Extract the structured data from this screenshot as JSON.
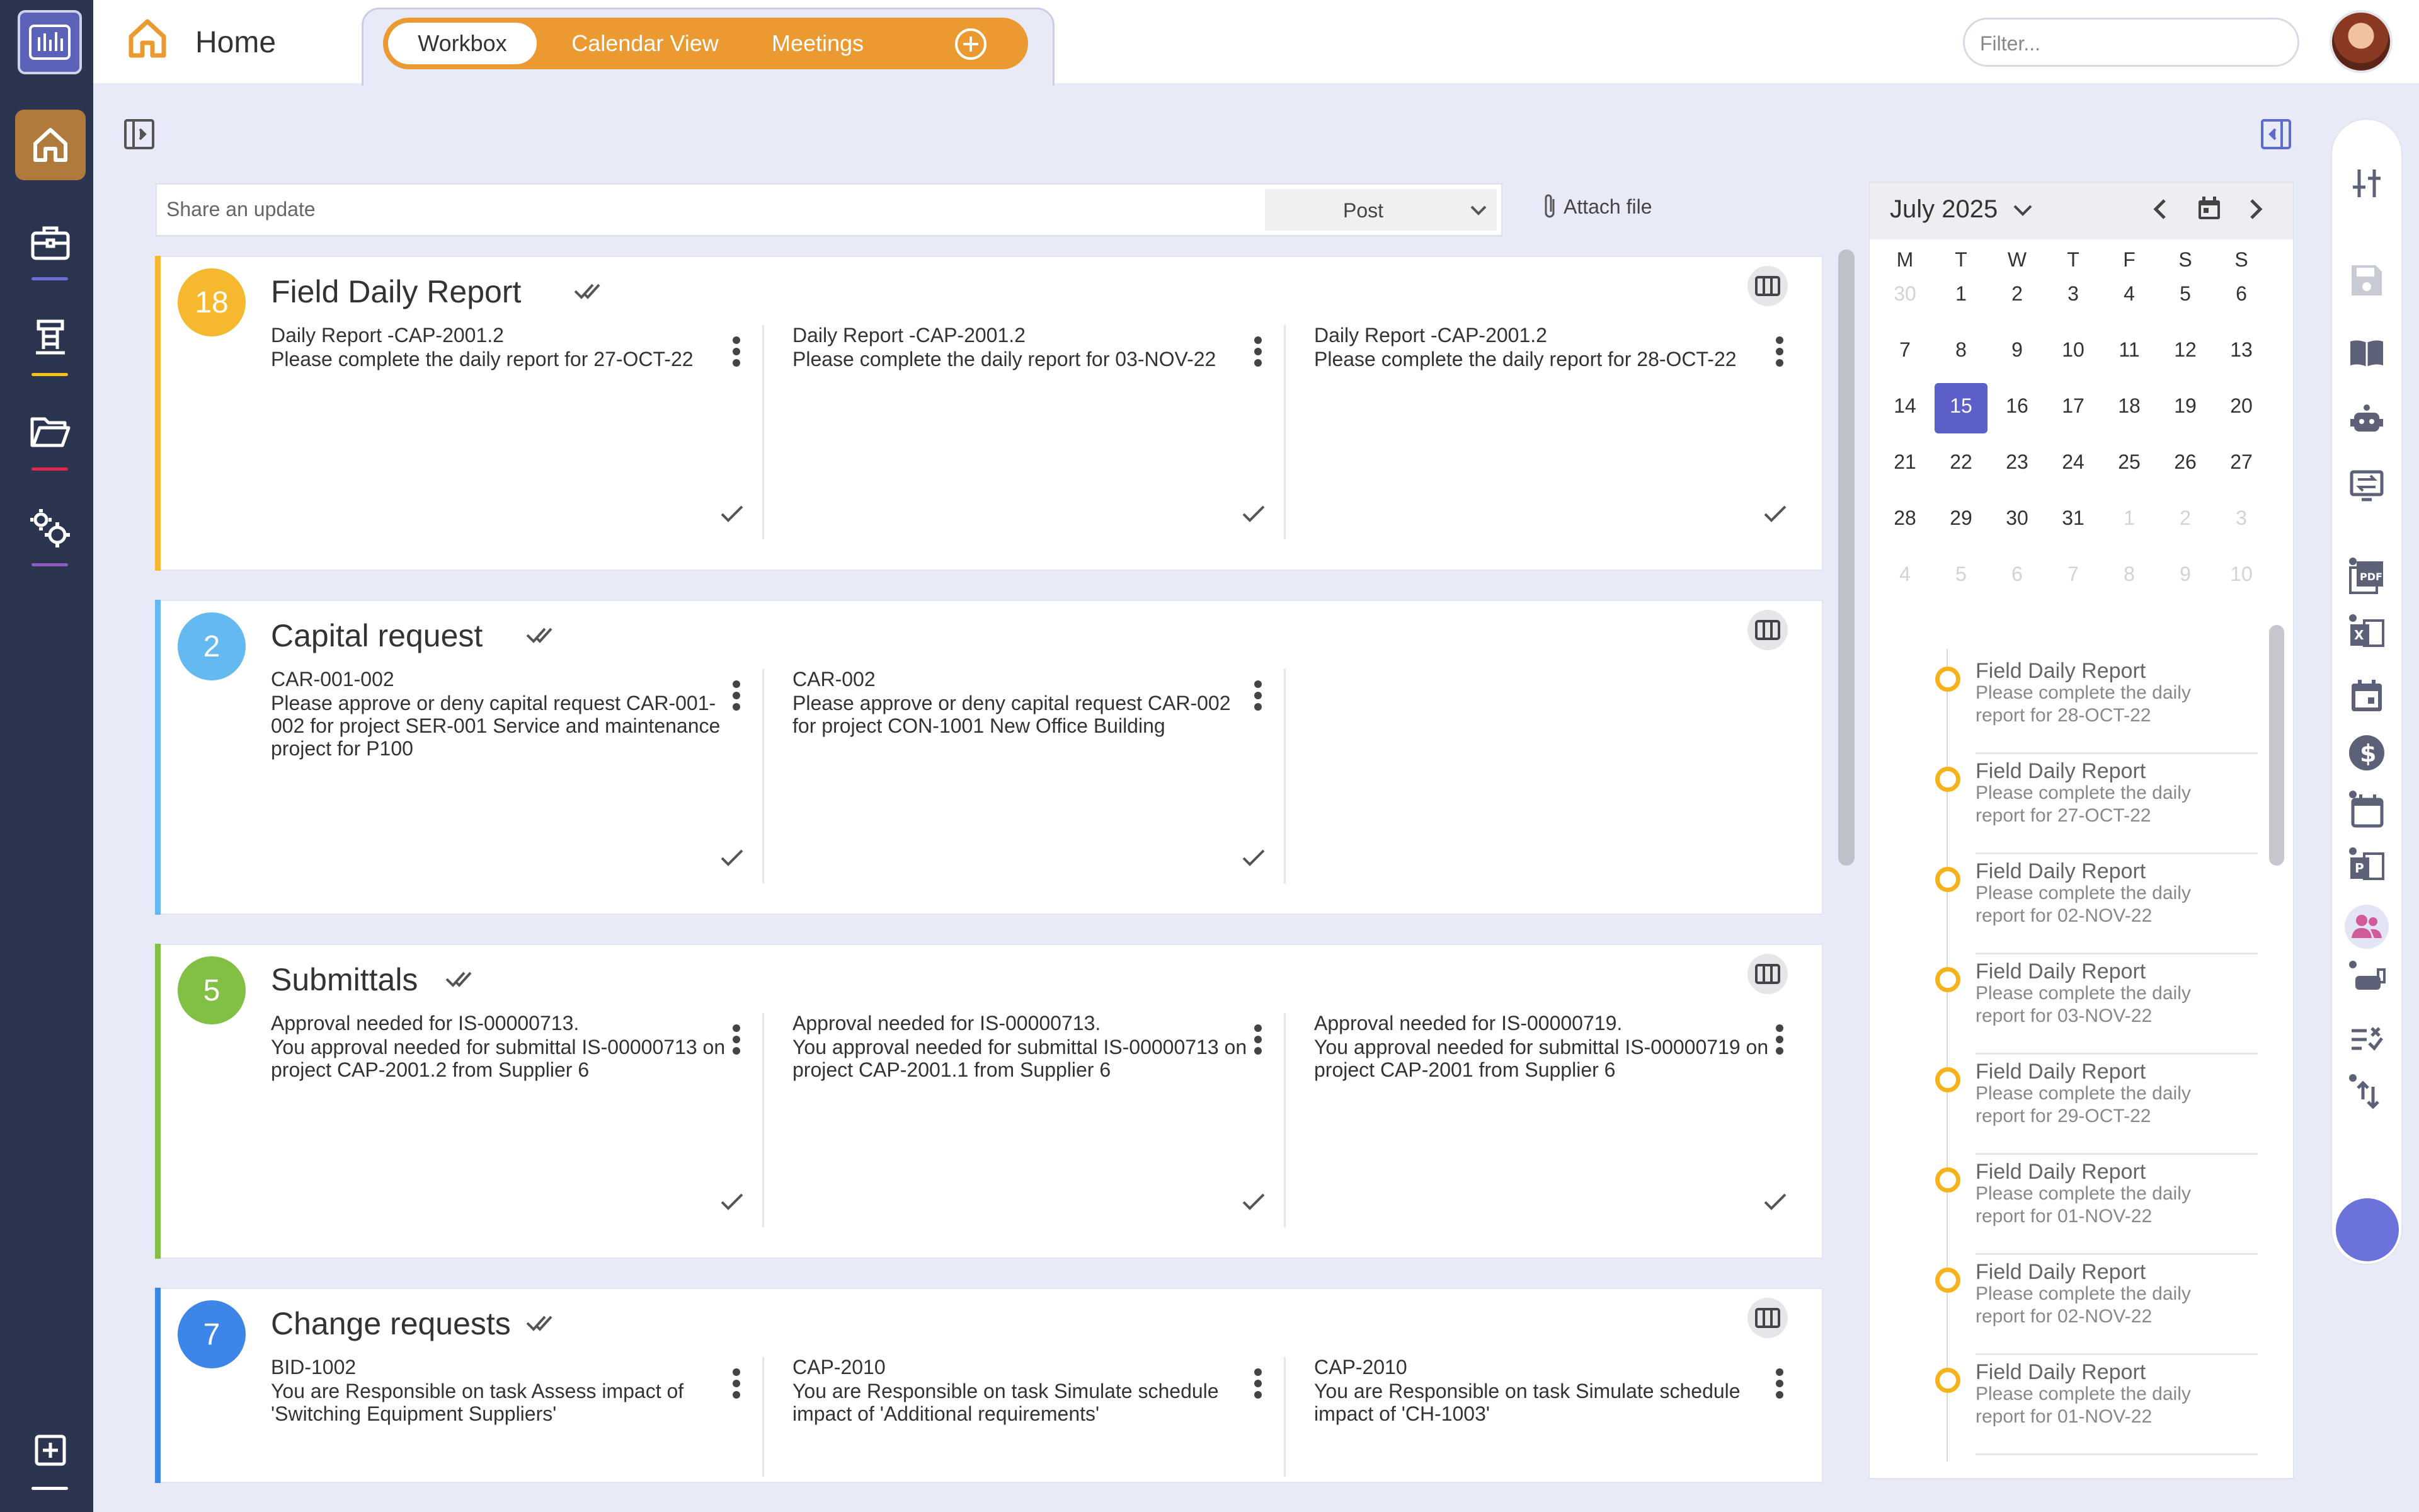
{
  "header": {
    "home_label": "Home",
    "tabs": [
      {
        "label": "Workbox",
        "active": true
      },
      {
        "label": "Calendar View",
        "active": false
      },
      {
        "label": "Meetings",
        "active": false
      }
    ],
    "filter_placeholder": "Filter..."
  },
  "compose": {
    "placeholder": "Share an update",
    "post_label": "Post",
    "attach_label": "Attach file"
  },
  "cards": [
    {
      "title": "Field Daily Report",
      "count": "18",
      "color": "#f5b82e",
      "items": [
        {
          "title": "Daily Report -CAP-2001.2",
          "body": "Please complete the daily report for 27-OCT-22"
        },
        {
          "title": "Daily Report -CAP-2001.2",
          "body": "Please complete the daily report for 03-NOV-22"
        },
        {
          "title": "Daily Report -CAP-2001.2",
          "body": "Please complete the daily report for 28-OCT-22"
        }
      ]
    },
    {
      "title": "Capital request",
      "count": "2",
      "color": "#64baf0",
      "items": [
        {
          "title": "CAR-001-002",
          "body": "Please approve or deny capital request CAR-001-002 for project SER-001 Service and maintenance project for P100"
        },
        {
          "title": "CAR-002",
          "body": "Please approve or deny capital request CAR-002 for project CON-1001 New Office Building"
        }
      ]
    },
    {
      "title": "Submittals",
      "count": "5",
      "color": "#82bf45",
      "items": [
        {
          "title": "Approval needed for IS-00000713.",
          "body": "You approval needed for submittal IS-00000713 on project CAP-2001.2 from Supplier 6"
        },
        {
          "title": "Approval needed for IS-00000713.",
          "body": "You approval needed for submittal IS-00000713 on project CAP-2001.1 from Supplier 6"
        },
        {
          "title": "Approval needed for IS-00000719.",
          "body": "You approval needed for submittal IS-00000719 on project CAP-2001 from Supplier 6"
        }
      ]
    },
    {
      "title": "Change requests",
      "count": "7",
      "color": "#3d86e8",
      "items": [
        {
          "title": "BID-1002",
          "body": "You are Responsible on task Assess impact of 'Switching Equipment Suppliers'"
        },
        {
          "title": "CAP-2010",
          "body": "You are Responsible on task Simulate schedule impact of 'Additional requirements'"
        },
        {
          "title": "CAP-2010",
          "body": "You are Responsible on task Simulate schedule impact of 'CH-1003'"
        }
      ]
    }
  ],
  "calendar": {
    "month_label": "July 2025",
    "weekdays": [
      "M",
      "T",
      "W",
      "T",
      "F",
      "S",
      "S"
    ],
    "weeks": [
      [
        "30",
        "1",
        "2",
        "3",
        "4",
        "5",
        "6"
      ],
      [
        "7",
        "8",
        "9",
        "10",
        "11",
        "12",
        "13"
      ],
      [
        "14",
        "15",
        "16",
        "17",
        "18",
        "19",
        "20"
      ],
      [
        "21",
        "22",
        "23",
        "24",
        "25",
        "26",
        "27"
      ],
      [
        "28",
        "29",
        "30",
        "31",
        "1",
        "2",
        "3"
      ],
      [
        "4",
        "5",
        "6",
        "7",
        "8",
        "9",
        "10"
      ]
    ],
    "today": "15",
    "timeline": [
      {
        "title": "Field Daily Report",
        "body": "Please complete the daily report for 28-OCT-22"
      },
      {
        "title": "Field Daily Report",
        "body": "Please complete the daily report for 27-OCT-22"
      },
      {
        "title": "Field Daily Report",
        "body": "Please complete the daily report for 02-NOV-22"
      },
      {
        "title": "Field Daily Report",
        "body": "Please complete the daily report for 03-NOV-22"
      },
      {
        "title": "Field Daily Report",
        "body": "Please complete the daily report for 29-OCT-22"
      },
      {
        "title": "Field Daily Report",
        "body": "Please complete the daily report for 01-NOV-22"
      },
      {
        "title": "Field Daily Report",
        "body": "Please complete the daily report for 02-NOV-22"
      },
      {
        "title": "Field Daily Report",
        "body": "Please complete the daily report for 01-NOV-22"
      }
    ]
  },
  "colors": {
    "accent_orange": "#eb9a32",
    "sidebar": "#2c3550",
    "active_nav": "#b07a3c",
    "today": "#5c5fc7",
    "timeline_dot": "#f6b21b"
  }
}
